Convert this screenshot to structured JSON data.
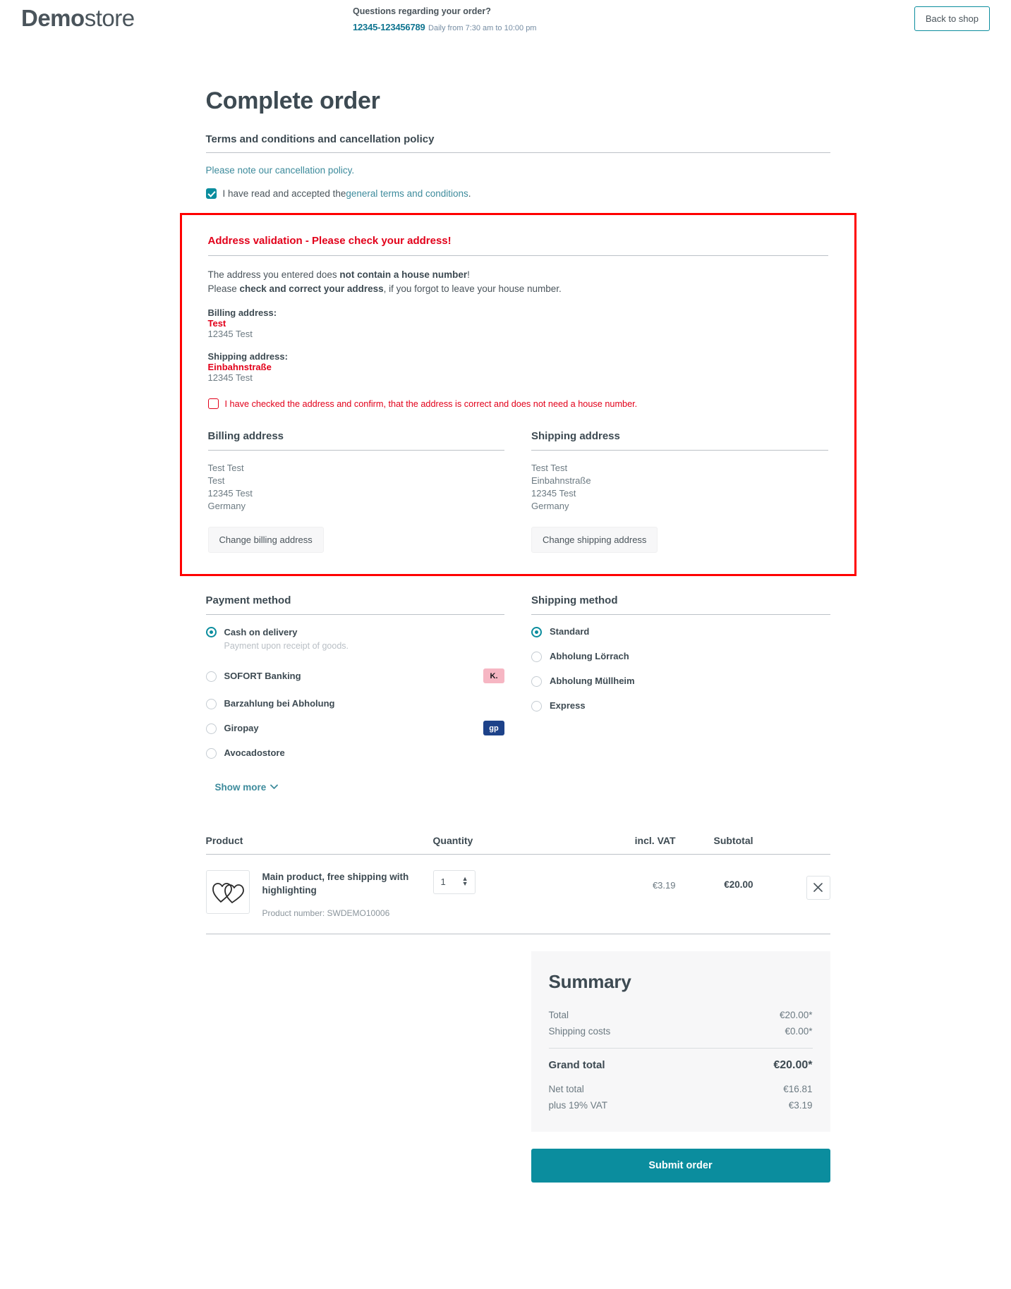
{
  "header": {
    "logo_bold": "Demo",
    "logo_light": "store",
    "question": "Questions regarding your order?",
    "phone": "12345-123456789",
    "hours": "Daily from 7:30 am to 10:00 pm",
    "back_to_shop": "Back to shop"
  },
  "page": {
    "title": "Complete order"
  },
  "terms": {
    "heading": "Terms and conditions and cancellation policy",
    "cancellation_link": "Please note our cancellation policy.",
    "accept_prefix": "I have read and accepted the ",
    "accept_link": "general terms and conditions",
    "accept_suffix": ".",
    "accepted": true
  },
  "validation": {
    "title": "Address validation - Please check your address!",
    "line1_a": "The address you entered does ",
    "line1_b": "not contain a house number",
    "line1_c": "!",
    "line2_a": "Please ",
    "line2_b": "check and correct your address",
    "line2_c": ", if you forgot to leave your house number.",
    "billing_label": "Billing address:",
    "billing_street": "Test",
    "billing_city": "12345 Test",
    "shipping_label": "Shipping address:",
    "shipping_street": "Einbahnstraße",
    "shipping_city": "12345 Test",
    "confirm_text": "I have checked the address and confirm, that the address is correct and does not need a house number.",
    "confirm_checked": false
  },
  "billing_address": {
    "heading": "Billing address",
    "lines": [
      "Test Test",
      "Test",
      "12345 Test",
      "Germany"
    ],
    "change_button": "Change billing address"
  },
  "shipping_address": {
    "heading": "Shipping address",
    "lines": [
      "Test Test",
      "Einbahnstraße",
      "12345 Test",
      "Germany"
    ],
    "change_button": "Change shipping address"
  },
  "payment": {
    "heading": "Payment method",
    "show_more": "Show more",
    "options": [
      {
        "label": "Cash on delivery",
        "desc": "Payment upon receipt of goods.",
        "selected": true,
        "logo": null
      },
      {
        "label": "SOFORT Banking",
        "desc": null,
        "selected": false,
        "logo": "K."
      },
      {
        "label": "Barzahlung bei Abholung",
        "desc": null,
        "selected": false,
        "logo": null
      },
      {
        "label": "Giropay",
        "desc": null,
        "selected": false,
        "logo": "gp"
      },
      {
        "label": "Avocadostore",
        "desc": null,
        "selected": false,
        "logo": null
      }
    ]
  },
  "shipping": {
    "heading": "Shipping method",
    "options": [
      {
        "label": "Standard",
        "selected": true
      },
      {
        "label": "Abholung Lörrach",
        "selected": false
      },
      {
        "label": "Abholung Müllheim",
        "selected": false
      },
      {
        "label": "Express",
        "selected": false
      }
    ]
  },
  "cart": {
    "columns": [
      "Product",
      "Quantity",
      "incl. VAT",
      "Subtotal"
    ],
    "rows": [
      {
        "name": "Main product, free shipping with highlighting",
        "product_number": "Product number: SWDEMO10006",
        "quantity": "1",
        "vat": "€3.19",
        "subtotal": "€20.00"
      }
    ]
  },
  "summary": {
    "title": "Summary",
    "rows": [
      {
        "label": "Total",
        "value": "€20.00*"
      },
      {
        "label": "Shipping costs",
        "value": "€0.00*"
      }
    ],
    "grand_total_label": "Grand total",
    "grand_total_value": "€20.00*",
    "net_rows": [
      {
        "label": "Net total",
        "value": "€16.81"
      },
      {
        "label": "plus 19% VAT",
        "value": "€3.19"
      }
    ],
    "submit_label": "Submit order"
  },
  "colors": {
    "brand_teal": "#0b8d9e",
    "error_red": "#e2001a",
    "highlight_red": "#ff0000",
    "link": "#3d8b9c",
    "text": "#4a545b"
  }
}
